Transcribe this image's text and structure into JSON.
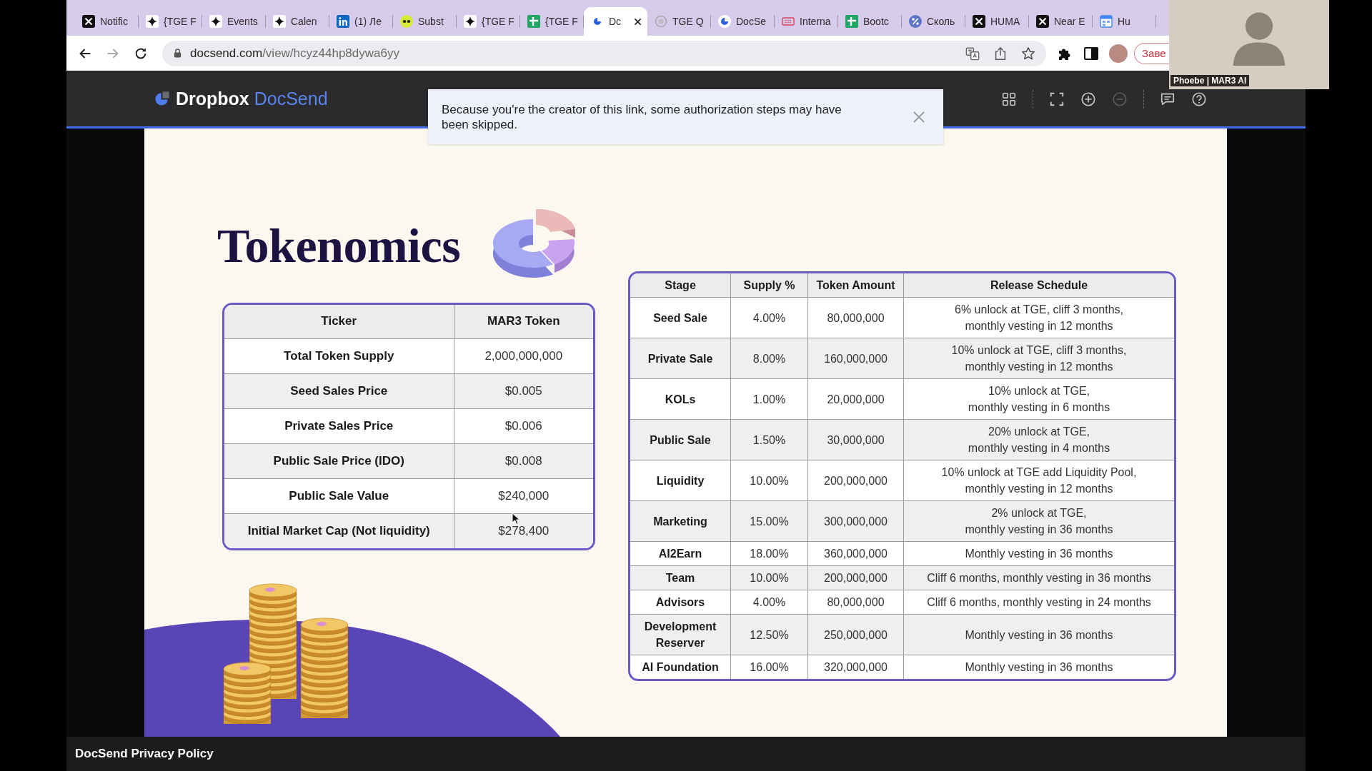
{
  "browser": {
    "tabs": [
      {
        "title": "Notific",
        "selected": false
      },
      {
        "title": "{TGE F",
        "selected": false
      },
      {
        "title": "Events",
        "selected": false
      },
      {
        "title": "Calen",
        "selected": false
      },
      {
        "title": "(1) Ле",
        "selected": false
      },
      {
        "title": "Subst",
        "selected": false
      },
      {
        "title": "{TGE F",
        "selected": false
      },
      {
        "title": "{TGE F",
        "selected": false
      },
      {
        "title": "Dc",
        "selected": true
      },
      {
        "title": "TGE Q",
        "selected": false
      },
      {
        "title": "DocSe",
        "selected": false
      },
      {
        "title": "Interna",
        "selected": false
      },
      {
        "title": "Bootc",
        "selected": false
      },
      {
        "title": "Сколь",
        "selected": false
      },
      {
        "title": "HUMA",
        "selected": false
      },
      {
        "title": "Near E",
        "selected": false
      },
      {
        "title": "Hu",
        "selected": false
      }
    ],
    "address_bar": {
      "host": "docsend.com",
      "path": "/view/hcyz44hp8dywa6yy"
    },
    "update_button": {
      "label": "Заве"
    }
  },
  "video_call": {
    "participant": "Phoebe | MAR3 AI"
  },
  "docsend": {
    "brand": {
      "company": "Dropbox",
      "product": "DocSend"
    },
    "toolbar": [
      {
        "disabled": false
      },
      {
        "disabled": false
      },
      {
        "disabled": false
      },
      {
        "disabled": true
      },
      {
        "disabled": false
      },
      {
        "disabled": false
      }
    ],
    "notice": {
      "message": "Because you're the creator of this link, some authorization steps may have been skipped."
    },
    "footer_link": "DocSend Privacy Policy"
  },
  "slide": {
    "title": "Tokenomics",
    "ticker_table": {
      "columns": [
        "Ticker",
        "MAR3 Token"
      ],
      "rows": [
        [
          "Total Token Supply",
          "2,000,000,000"
        ],
        [
          "Seed Sales Price",
          "$0.005"
        ],
        [
          "Private Sales Price",
          "$0.006"
        ],
        [
          "Public Sale Price (IDO)",
          "$0.008"
        ],
        [
          "Public Sale Value",
          "$240,000"
        ],
        [
          "Initial Market Cap (Not liquidity)",
          "$278,400"
        ]
      ]
    },
    "allocation_table": {
      "columns": [
        "Stage",
        "Supply %",
        "Token Amount",
        "Release Schedule"
      ],
      "rows": [
        [
          "Seed Sale",
          "4.00%",
          "80,000,000",
          "6% unlock at TGE, cliff 3 months,\nmonthly vesting in 12 months"
        ],
        [
          "Private Sale",
          "8.00%",
          "160,000,000",
          "10% unlock at TGE, cliff 3 months,\nmonthly vesting in 12 months"
        ],
        [
          "KOLs",
          "1.00%",
          "20,000,000",
          "10% unlock at TGE,\nmonthly vesting in 6 months"
        ],
        [
          "Public Sale",
          "1.50%",
          "30,000,000",
          "20% unlock at TGE,\nmonthly vesting in 4 months"
        ],
        [
          "Liquidity",
          "10.00%",
          "200,000,000",
          "10% unlock at TGE add Liquidity Pool,\nmonthly vesting in 12 months"
        ],
        [
          "Marketing",
          "15.00%",
          "300,000,000",
          "2% unlock at TGE,\nmonthly vesting in 36 months"
        ],
        [
          "AI2Earn",
          "18.00%",
          "360,000,000",
          "Monthly vesting in 36 months"
        ],
        [
          "Team",
          "10.00%",
          "200,000,000",
          "Cliff 6 months, monthly vesting in 36 months"
        ],
        [
          "Advisors",
          "4.00%",
          "80,000,000",
          "Cliff 6 months, monthly vesting in 24 months"
        ],
        [
          "Development Reserver",
          "12.50%",
          "250,000,000",
          "Monthly vesting in 36 months"
        ],
        [
          "AI Foundation",
          "16.00%",
          "320,000,000",
          "Monthly vesting in 36 months"
        ]
      ]
    }
  }
}
